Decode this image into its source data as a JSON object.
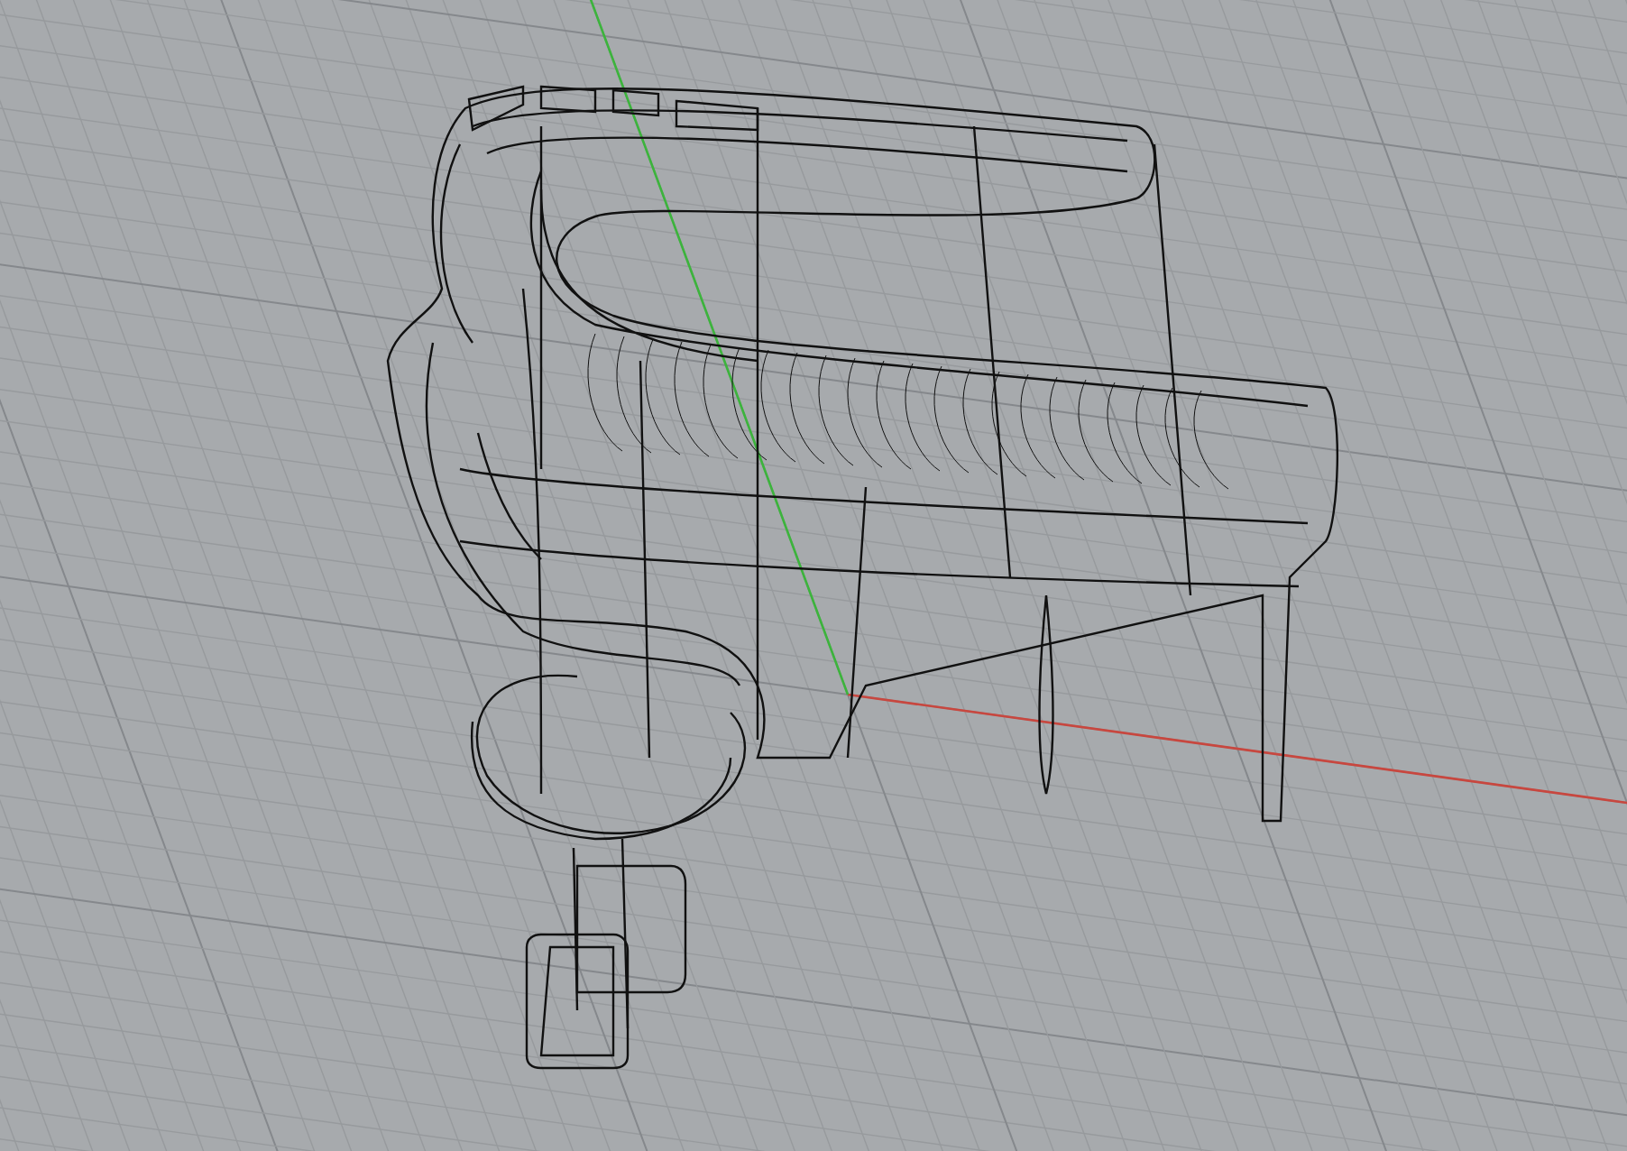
{
  "viewport": {
    "axes": [
      {
        "kind": "x",
        "color": "#c8473f"
      },
      {
        "kind": "y",
        "color": "#3cb43c"
      }
    ]
  }
}
